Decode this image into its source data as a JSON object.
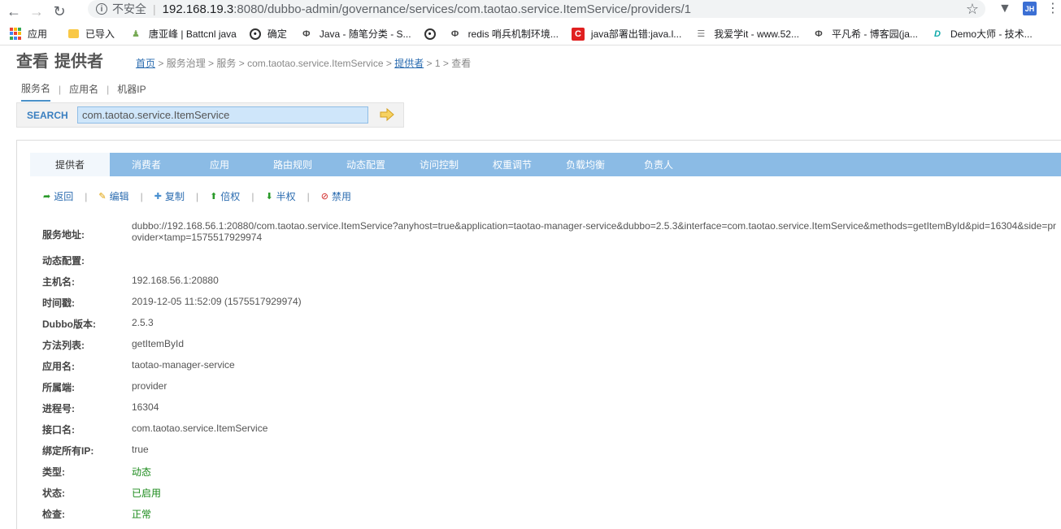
{
  "browser": {
    "security_label": "不安全",
    "url_host": "192.168.19.3",
    "url_path": ":8080/dubbo-admin/governance/services/com.taotao.service.ItemService/providers/1",
    "ext_jh": "JH"
  },
  "bookmarks": [
    {
      "label": "应用",
      "icon": "apps-icon"
    },
    {
      "label": "已导入",
      "icon": "folder-icon"
    },
    {
      "label": "唐亚峰 | Battcnl java",
      "icon": "user-icon"
    },
    {
      "label": "确定",
      "icon": "globe-icon"
    },
    {
      "label": "Java - 随笔分类 - S...",
      "icon": "swirl-icon"
    },
    {
      "label": "",
      "icon": "globe-icon"
    },
    {
      "label": "redis 哨兵机制环境...",
      "icon": "swirl-icon"
    },
    {
      "label": "java部署出错:java.l...",
      "icon": "csdn-icon"
    },
    {
      "label": "我爱学it - www.52...",
      "icon": "book-icon"
    },
    {
      "label": "平凡希 - 博客园(ja...",
      "icon": "swirl-icon"
    },
    {
      "label": "Demo大师 - 技术...",
      "icon": "d-icon"
    }
  ],
  "page": {
    "title": "查看 提供者",
    "breadcrumb": {
      "home": "首页",
      "sep": " > ",
      "governance": "服务治理",
      "services": "服务",
      "service_name": "com.taotao.service.ItemService",
      "providers": "提供者",
      "id": "1",
      "view": "查看"
    }
  },
  "search": {
    "tabs": [
      "服务名",
      "应用名",
      "机器IP"
    ],
    "active_tab": "服务名",
    "label": "SEARCH",
    "value": "com.taotao.service.ItemService"
  },
  "tabs": [
    {
      "label": "提供者",
      "active": true
    },
    {
      "label": "消费者",
      "active": false
    },
    {
      "label": "应用",
      "active": false
    },
    {
      "label": "路由规则",
      "active": false
    },
    {
      "label": "动态配置",
      "active": false
    },
    {
      "label": "访问控制",
      "active": false
    },
    {
      "label": "权重调节",
      "active": false
    },
    {
      "label": "负载均衡",
      "active": false
    },
    {
      "label": "负责人",
      "active": false
    }
  ],
  "actions": {
    "back": "返回",
    "edit": "编辑",
    "copy": "复制",
    "double": "倍权",
    "half": "半权",
    "disable": "禁用",
    "sep": "|"
  },
  "details": {
    "address": {
      "label": "服务地址:",
      "value": "dubbo://192.168.56.1:20880/com.taotao.service.ItemService?anyhost=true&application=taotao-manager-service&dubbo=2.5.3&interface=com.taotao.service.ItemService&methods=getItemById&pid=16304&side=provider×tamp=1575517929974"
    },
    "dynamic": {
      "label": "动态配置:",
      "value": ""
    },
    "host": {
      "label": "主机名:",
      "value": "192.168.56.1:20880"
    },
    "timestamp": {
      "label": "时间戳:",
      "value": "2019-12-05 11:52:09 (1575517929974)"
    },
    "version": {
      "label": "Dubbo版本:",
      "value": "2.5.3"
    },
    "methods": {
      "label": "方法列表:",
      "value": "getItemById"
    },
    "application": {
      "label": "应用名:",
      "value": "taotao-manager-service"
    },
    "side": {
      "label": "所属端:",
      "value": "provider"
    },
    "pid": {
      "label": "进程号:",
      "value": "16304"
    },
    "interface": {
      "label": "接口名:",
      "value": "com.taotao.service.ItemService"
    },
    "anyhost": {
      "label": "绑定所有IP:",
      "value": "true"
    },
    "type": {
      "label": "类型:",
      "value": "动态"
    },
    "status": {
      "label": "状态:",
      "value": "已启用"
    },
    "check": {
      "label": "检查:",
      "value": "正常"
    }
  },
  "colors": {
    "tab_bar": "#8bbbe5",
    "link": "#2b6cb0",
    "ok_green": "#1a8a1a"
  }
}
